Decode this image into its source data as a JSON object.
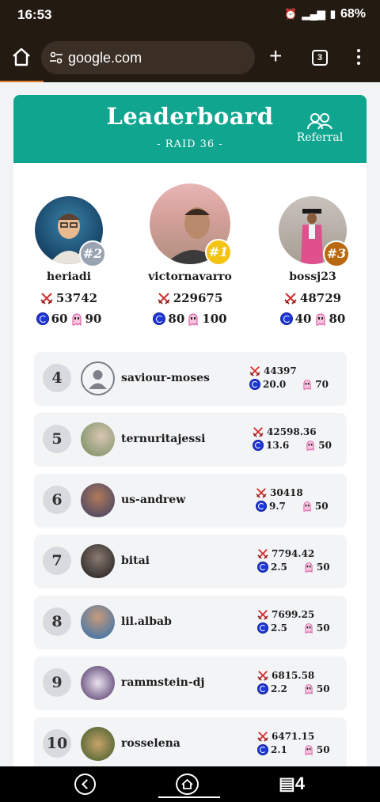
{
  "status_bar": {
    "time": "16:53",
    "battery": "68%"
  },
  "browser": {
    "url": "google.com",
    "tab_count": "3"
  },
  "header": {
    "title": "Leaderboard",
    "subtitle": "- RAID 36 -",
    "referral_label": "Referral"
  },
  "colors": {
    "header_bg": "#0fa58f",
    "rank1": "#f2c414",
    "rank2": "#9aa3b2",
    "rank3": "#b8690f"
  },
  "podium": [
    {
      "rank": "#2",
      "name": "heriadi",
      "score": "53742",
      "coins": "60",
      "ghosts": "90"
    },
    {
      "rank": "#1",
      "name": "victornavarro",
      "score": "229675",
      "coins": "80",
      "ghosts": "100"
    },
    {
      "rank": "#3",
      "name": "bossj23",
      "score": "48729",
      "coins": "40",
      "ghosts": "80"
    }
  ],
  "rows": [
    {
      "rank": "4",
      "name": "saviour-moses",
      "score": "44397",
      "coins": "20.0",
      "ghosts": "70",
      "avatar": "default-user-icon"
    },
    {
      "rank": "5",
      "name": "ternuritajessi",
      "score": "42598.36",
      "coins": "13.6",
      "ghosts": "50"
    },
    {
      "rank": "6",
      "name": "us-andrew",
      "score": "30418",
      "coins": "9.7",
      "ghosts": "50"
    },
    {
      "rank": "7",
      "name": "bitai",
      "score": "7794.42",
      "coins": "2.5",
      "ghosts": "50"
    },
    {
      "rank": "8",
      "name": "lil.albab",
      "score": "7699.25",
      "coins": "2.5",
      "ghosts": "50"
    },
    {
      "rank": "9",
      "name": "rammstein-dj",
      "score": "6815.58",
      "coins": "2.2",
      "ghosts": "50"
    },
    {
      "rank": "10",
      "name": "rosselena",
      "score": "6471.15",
      "coins": "2.1",
      "ghosts": "50"
    }
  ]
}
